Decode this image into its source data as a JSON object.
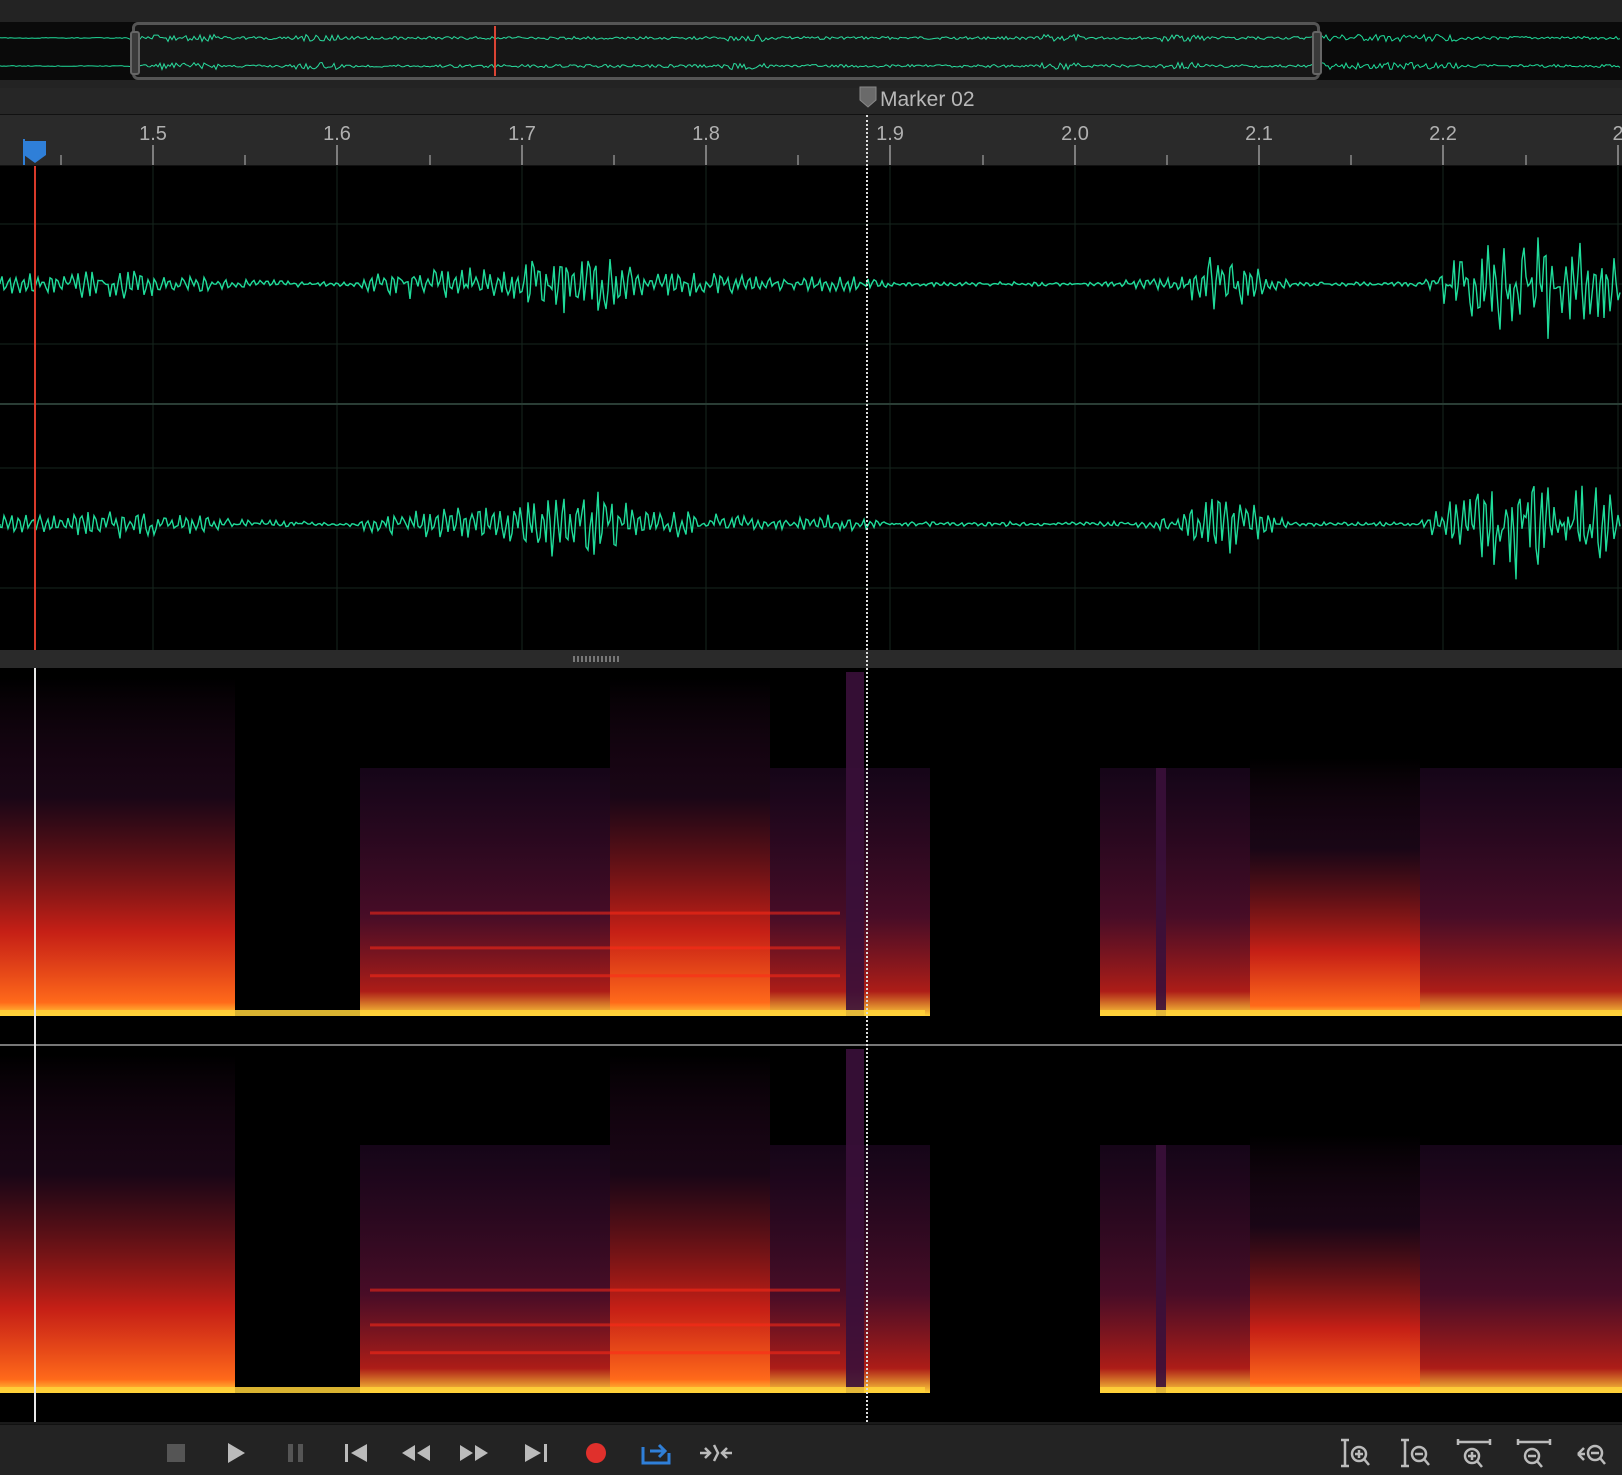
{
  "marker": {
    "label": "Marker 02",
    "time": 1.887
  },
  "ruler": {
    "ticks": [
      "1.5",
      "1.6",
      "1.7",
      "1.8",
      "1.9",
      "2.0",
      "2.1",
      "2.2",
      "2"
    ]
  },
  "playhead": {
    "time": 1.436
  },
  "transport": {
    "buttons": [
      "stop",
      "play",
      "pause",
      "move-to-previous",
      "rewind",
      "fast-forward",
      "move-to-next",
      "record",
      "loop-playback",
      "skip-selection"
    ]
  },
  "zoom": {
    "buttons": [
      "zoom-in-amplitude",
      "zoom-out-amplitude",
      "zoom-in-time",
      "zoom-out-time",
      "zoom-out-full"
    ]
  },
  "colors": {
    "waveform": "#1fdc9a",
    "playhead": "#d83a2a",
    "cursor": "#2f7fd8",
    "record": "#e0302c",
    "spectral_hot": "#ffd23a",
    "spectral_mid": "#e8251a",
    "spectral_low": "#4a0f3a"
  }
}
